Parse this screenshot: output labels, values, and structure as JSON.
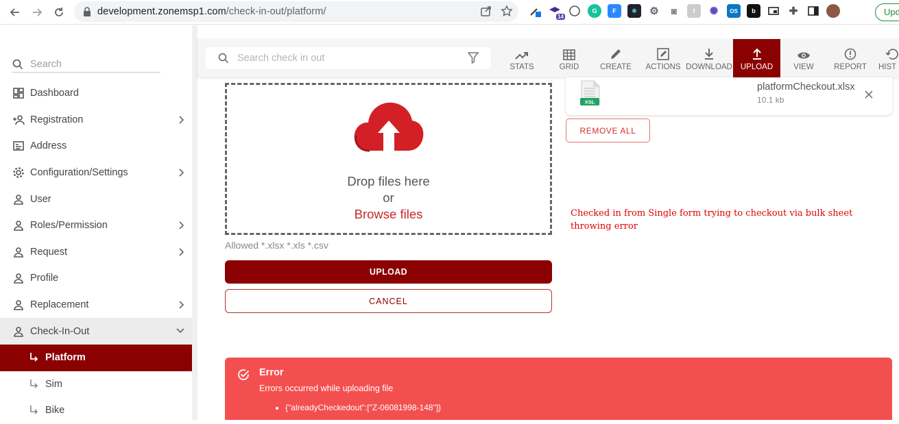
{
  "browser": {
    "url_host": "development.zonemsp1.com",
    "url_path": "/check-in-out/platform/",
    "badge_count": "14",
    "update_label": "Upd"
  },
  "sidebar": {
    "search_placeholder": "Search",
    "items": [
      {
        "label": "Dashboard",
        "icon": "dashboard-icon",
        "expandable": false
      },
      {
        "label": "Registration",
        "icon": "person-add-icon",
        "expandable": true
      },
      {
        "label": "Address",
        "icon": "address-card-icon",
        "expandable": false
      },
      {
        "label": "Configuration/Settings",
        "icon": "gear-icon",
        "expandable": true
      },
      {
        "label": "User",
        "icon": "person-icon",
        "expandable": false
      },
      {
        "label": "Roles/Permission",
        "icon": "person-icon",
        "expandable": true
      },
      {
        "label": "Request",
        "icon": "person-icon",
        "expandable": true
      },
      {
        "label": "Profile",
        "icon": "person-icon",
        "expandable": false
      },
      {
        "label": "Replacement",
        "icon": "person-icon",
        "expandable": true
      },
      {
        "label": "Check-In-Out",
        "icon": "person-icon",
        "expandable": true,
        "open": true
      }
    ],
    "subitems": [
      {
        "label": "Platform",
        "active": true
      },
      {
        "label": "Sim",
        "active": false
      },
      {
        "label": "Bike",
        "active": false
      }
    ]
  },
  "toolbar": {
    "search_placeholder": "Search check in out",
    "buttons": [
      {
        "label": "STATS",
        "icon": "trending-up-icon"
      },
      {
        "label": "GRID",
        "icon": "grid-icon"
      },
      {
        "label": "CREATE",
        "icon": "pencil-icon"
      },
      {
        "label": "ACTIONS",
        "icon": "edit-box-icon"
      },
      {
        "label": "DOWNLOAD",
        "icon": "download-icon"
      },
      {
        "label": "UPLOAD",
        "icon": "upload-icon",
        "active": true
      },
      {
        "label": "VIEW",
        "icon": "eye-icon"
      },
      {
        "label": "REPORT",
        "icon": "alert-circle-icon"
      },
      {
        "label": "HIST",
        "icon": "history-icon"
      }
    ]
  },
  "dropzone": {
    "line1": "Drop files here",
    "line2": "or",
    "browse": "Browse files",
    "allowed": "Allowed *.xlsx *.xls *.csv"
  },
  "actions": {
    "upload": "UPLOAD",
    "cancel": "CANCEL",
    "remove_all": "REMOVE ALL"
  },
  "file": {
    "badge": "XSL",
    "name": "platformCheckout.xlsx",
    "size": "10.1 kb"
  },
  "annotation": "Checked in from Single form trying to checkout via bulk sheet throwing error",
  "error": {
    "title": "Error",
    "message": "Errors occurred while uploading file",
    "details": [
      "{\"alreadyCheckedout\":[\"Z-06081998-148\"]}"
    ]
  },
  "colors": {
    "brand": "#8b0000",
    "error_bg": "#f44f4f",
    "cloud": "#d32027"
  }
}
